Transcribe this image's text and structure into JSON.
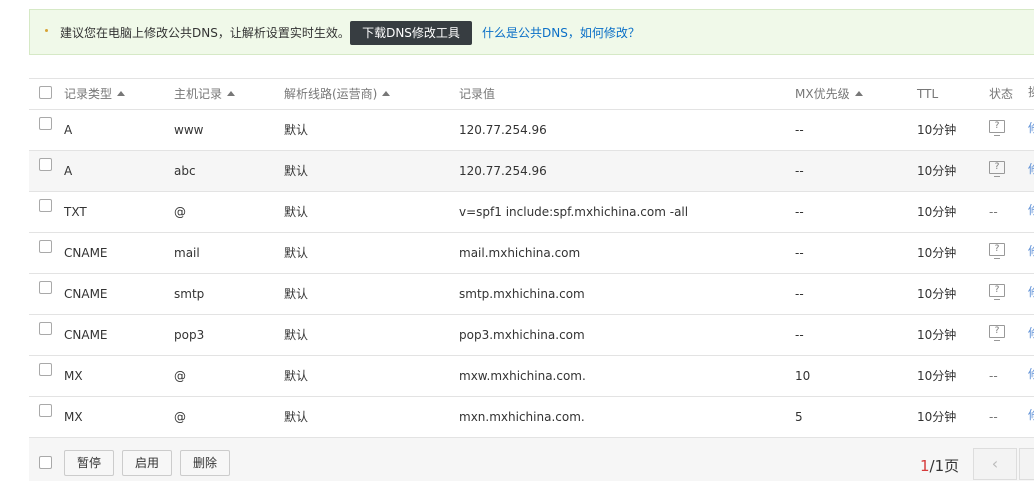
{
  "notice": {
    "text": "建议您在电脑上修改公共DNS，让解析设置实时生效。",
    "button": "下载DNS修改工具",
    "link": "什么是公共DNS，如何修改？"
  },
  "table": {
    "columns": {
      "type": "记录类型",
      "host": "主机记录",
      "line": "解析线路(运营商)",
      "value": "记录值",
      "mx": "MX优先级",
      "ttl": "TTL",
      "status": "状态",
      "op": "操"
    },
    "rows": [
      {
        "type": "A",
        "host": "www",
        "line": "默认",
        "value": "120.77.254.96",
        "mx": "--",
        "ttl": "10分钟",
        "status": "?",
        "op": "修"
      },
      {
        "type": "A",
        "host": "abc",
        "line": "默认",
        "value": "120.77.254.96",
        "mx": "--",
        "ttl": "10分钟",
        "status": "?",
        "op": "修"
      },
      {
        "type": "TXT",
        "host": "@",
        "line": "默认",
        "value": "v=spf1 include:spf.mxhichina.com -all",
        "mx": "--",
        "ttl": "10分钟",
        "status": "--",
        "op": "修"
      },
      {
        "type": "CNAME",
        "host": "mail",
        "line": "默认",
        "value": "mail.mxhichina.com",
        "mx": "--",
        "ttl": "10分钟",
        "status": "?",
        "op": "修"
      },
      {
        "type": "CNAME",
        "host": "smtp",
        "line": "默认",
        "value": "smtp.mxhichina.com",
        "mx": "--",
        "ttl": "10分钟",
        "status": "?",
        "op": "修"
      },
      {
        "type": "CNAME",
        "host": "pop3",
        "line": "默认",
        "value": "pop3.mxhichina.com",
        "mx": "--",
        "ttl": "10分钟",
        "status": "?",
        "op": "修"
      },
      {
        "type": "MX",
        "host": "@",
        "line": "默认",
        "value": "mxw.mxhichina.com.",
        "mx": "10",
        "ttl": "10分钟",
        "status": "--",
        "op": "修"
      },
      {
        "type": "MX",
        "host": "@",
        "line": "默认",
        "value": "mxn.mxhichina.com.",
        "mx": "5",
        "ttl": "10分钟",
        "status": "--",
        "op": "修"
      }
    ]
  },
  "footer": {
    "pause": "暂停",
    "enable": "启用",
    "delete": "删除",
    "page_current": "1",
    "page_rest": "/1页",
    "prev": "‹"
  }
}
